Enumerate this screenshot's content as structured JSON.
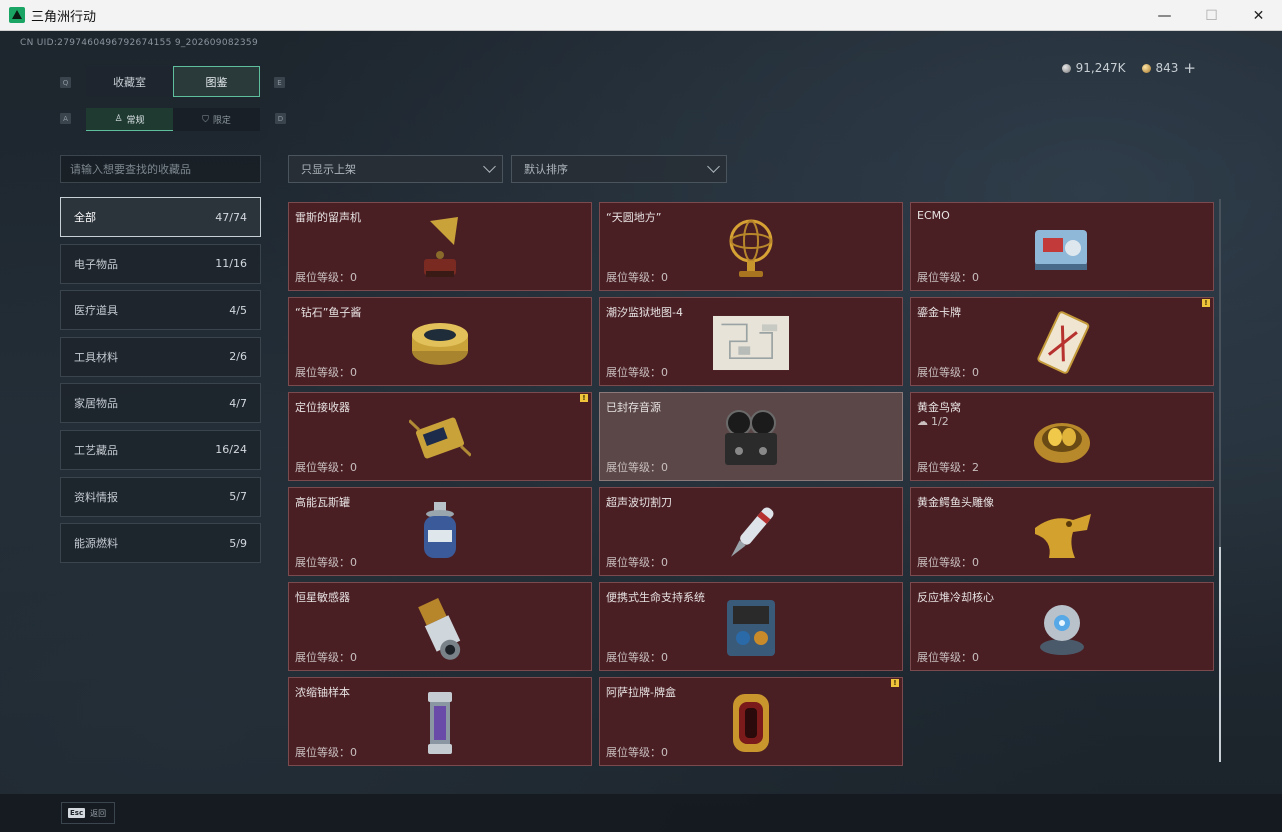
{
  "window": {
    "title": "三角洲行动",
    "minimize": "—",
    "maximize": "☐",
    "close": "✕"
  },
  "header": {
    "uid": "CN UID:2797460496792674155 9_202609082359",
    "silver": "91,247K",
    "gold": "843",
    "add": "+"
  },
  "tabs": {
    "key_left": "Q",
    "key_right": "E",
    "items": [
      {
        "label": "收藏室",
        "active": false
      },
      {
        "label": "图鉴",
        "active": true
      }
    ]
  },
  "subtabs": {
    "key_left": "A",
    "key_right": "D",
    "items": [
      {
        "label": "常规",
        "active": true
      },
      {
        "label": "限定",
        "active": false
      }
    ]
  },
  "search": {
    "placeholder": "请输入想要查找的收藏品",
    "value": ""
  },
  "categories": [
    {
      "label": "全部",
      "count": "47/74",
      "active": true
    },
    {
      "label": "电子物品",
      "count": "11/16"
    },
    {
      "label": "医疗道具",
      "count": "4/5"
    },
    {
      "label": "工具材料",
      "count": "2/6"
    },
    {
      "label": "家居物品",
      "count": "4/7"
    },
    {
      "label": "工艺藏品",
      "count": "16/24"
    },
    {
      "label": "资料情报",
      "count": "5/7"
    },
    {
      "label": "能源燃料",
      "count": "5/9"
    }
  ],
  "filters": {
    "show_filter": "只显示上架",
    "sort": "默认排序"
  },
  "items": [
    {
      "name": "雷斯的留声机",
      "level_label": "展位等级：",
      "level": "0",
      "icon": "gramophone-icon"
    },
    {
      "name": "“天圆地方”",
      "level_label": "展位等级：",
      "level": "0",
      "icon": "armillary-sphere-icon"
    },
    {
      "name": "ECMO",
      "level_label": "展位等级：",
      "level": "0",
      "icon": "ecmo-machine-icon"
    },
    {
      "name": "“钻石”鱼子酱",
      "level_label": "展位等级：",
      "level": "0",
      "icon": "caviar-tin-icon"
    },
    {
      "name": "潮汐监狱地图-4",
      "level_label": "展位等级：",
      "level": "0",
      "icon": "map-icon"
    },
    {
      "name": "鎏金卡牌",
      "level_label": "展位等级：",
      "level": "0",
      "icon": "gilded-card-icon",
      "alert": true
    },
    {
      "name": "定位接收器",
      "level_label": "展位等级：",
      "level": "0",
      "icon": "locator-receiver-icon",
      "alert": true
    },
    {
      "name": "已封存音源",
      "level_label": "展位等级：",
      "level": "0",
      "icon": "reel-recorder-icon",
      "sealed": true
    },
    {
      "name": "黄金鸟窝",
      "sub": "1/2",
      "level_label": "展位等级：",
      "level": "2",
      "icon": "golden-nest-icon"
    },
    {
      "name": "高能瓦斯罐",
      "level_label": "展位等级：",
      "level": "0",
      "icon": "gas-canister-icon"
    },
    {
      "name": "超声波切割刀",
      "level_label": "展位等级：",
      "level": "0",
      "icon": "ultrasonic-cutter-icon"
    },
    {
      "name": "黄金鳄鱼头雕像",
      "level_label": "展位等级：",
      "level": "0",
      "icon": "golden-crocodile-icon"
    },
    {
      "name": "恒星敏感器",
      "level_label": "展位等级：",
      "level": "0",
      "icon": "star-sensor-icon"
    },
    {
      "name": "便携式生命支持系统",
      "level_label": "展位等级：",
      "level": "0",
      "icon": "life-support-icon"
    },
    {
      "name": "反应堆冷却核心",
      "level_label": "展位等级：",
      "level": "0",
      "icon": "reactor-core-icon"
    },
    {
      "name": "浓缩铀样本",
      "level_label": "展位等级：",
      "level": "0",
      "icon": "uranium-sample-icon"
    },
    {
      "name": "阿萨拉牌-牌盒",
      "level_label": "展位等级：",
      "level": "0",
      "icon": "card-box-icon",
      "alert": true
    }
  ],
  "footer": {
    "esc_key": "Esc",
    "back_label": "返回"
  }
}
